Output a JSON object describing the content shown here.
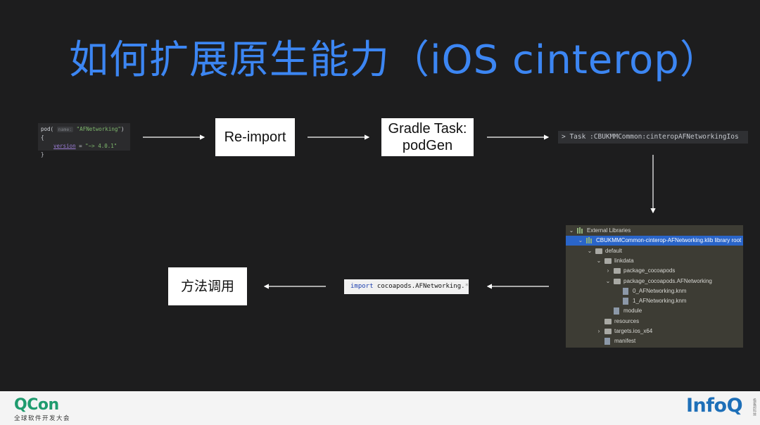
{
  "title": "如何扩展原生能力（iOS cinterop）",
  "code": {
    "fn": "pod(",
    "hint": "name:",
    "name": "\"AFNetworking\"",
    "brace_open": ") {",
    "prop": "version",
    "eq": " = ",
    "version": "\"~> 4.0.1\"",
    "brace_close": "}"
  },
  "boxes": {
    "reimport": "Re-import",
    "gradle_line1": "Gradle Task:",
    "gradle_line2": "podGen",
    "method_call": "方法调用"
  },
  "task_output": "> Task :CBUKMMCommon:cinteropAFNetworkingIos",
  "import_line": {
    "keyword": "import",
    "rest": " cocoapods.AFNetworking.",
    "star": "*"
  },
  "tree": {
    "rows": [
      {
        "label": "External Libraries",
        "indent": 0,
        "chev": "v",
        "icon": "library-icon"
      },
      {
        "label": "CBUKMMCommon-cinterop-AFNetworking.klib  library root",
        "indent": 1,
        "chev": "v",
        "icon": "library-icon",
        "selected": true
      },
      {
        "label": "default",
        "indent": 2,
        "chev": "v",
        "icon": "folder-icon"
      },
      {
        "label": "linkdata",
        "indent": 3,
        "chev": "v",
        "icon": "folder-icon"
      },
      {
        "label": "package_cocoapods",
        "indent": 4,
        "chev": ">",
        "icon": "folder-icon"
      },
      {
        "label": "package_cocoapods.AFNetworking",
        "indent": 4,
        "chev": "v",
        "icon": "folder-icon"
      },
      {
        "label": "0_AFNetworking.knm",
        "indent": 5,
        "chev": "",
        "icon": "file-icon"
      },
      {
        "label": "1_AFNetworking.knm",
        "indent": 5,
        "chev": "",
        "icon": "file-icon"
      },
      {
        "label": "module",
        "indent": 4,
        "chev": "",
        "icon": "file-icon"
      },
      {
        "label": "resources",
        "indent": 3,
        "chev": "",
        "icon": "folder-icon"
      },
      {
        "label": "targets.ios_x64",
        "indent": 3,
        "chev": ">",
        "icon": "folder-icon"
      },
      {
        "label": "manifest",
        "indent": 3,
        "chev": "",
        "icon": "file-icon"
      }
    ]
  },
  "footer": {
    "qcon": "QCon",
    "qcon_sub": "全球软件开发大会",
    "infoq": "InfoQ",
    "infoq_sub": "极客邦科技"
  },
  "colors": {
    "title": "#3c86f3",
    "background": "#1d1d1e",
    "selection": "#2a65c9",
    "qcon": "#1f9b6e",
    "infoq": "#1d6fb8"
  }
}
